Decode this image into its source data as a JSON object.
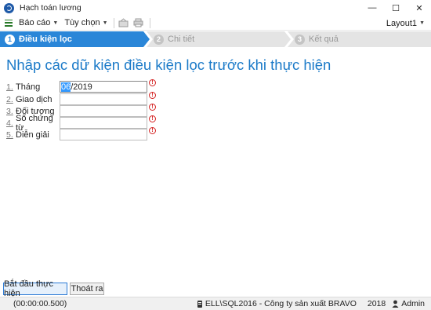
{
  "window": {
    "title": "Hạch toán lương",
    "minimize_icon": "—",
    "maximize_icon": "☐",
    "close_icon": "✕"
  },
  "menu": {
    "report_label": "Báo cáo",
    "options_label": "Tùy chọn",
    "layout_label": "Layout1"
  },
  "steps": [
    {
      "number": "1",
      "label": "Điều kiện lọc",
      "state": "active"
    },
    {
      "number": "2",
      "label": "Chi tiết",
      "state": "inactive"
    },
    {
      "number": "3",
      "label": "Kết quả",
      "state": "inactive"
    }
  ],
  "heading": "Nhập các dữ kiện điều kiện lọc trước khi thực hiện",
  "form": {
    "rows": [
      {
        "number": "1.",
        "label": "Tháng",
        "value_selected": "06",
        "value_rest": "/2019"
      },
      {
        "number": "2.",
        "label": "Giao dịch",
        "value_selected": "",
        "value_rest": ""
      },
      {
        "number": "3.",
        "label": "Đối tượng",
        "value_selected": "",
        "value_rest": ""
      },
      {
        "number": "4.",
        "label": "Số chứng từ",
        "value_selected": "",
        "value_rest": ""
      },
      {
        "number": "5.",
        "label": "Diễn giải",
        "value_selected": "",
        "value_rest": ""
      }
    ],
    "error_glyph": "!"
  },
  "buttons": {
    "start_label": "Bắt đầu thực hiện",
    "exit_label": "Thoát ra"
  },
  "status": {
    "elapsed": "(00:00:00.500)",
    "connection": "ELL\\SQL2016 - Công ty sản xuất BRAVO",
    "year": "2018",
    "user": "Admin"
  },
  "colors": {
    "accent": "#1b7ac8",
    "active_step": "#2a86d8",
    "inactive_step": "#e4e4e4",
    "error": "#d42020"
  }
}
